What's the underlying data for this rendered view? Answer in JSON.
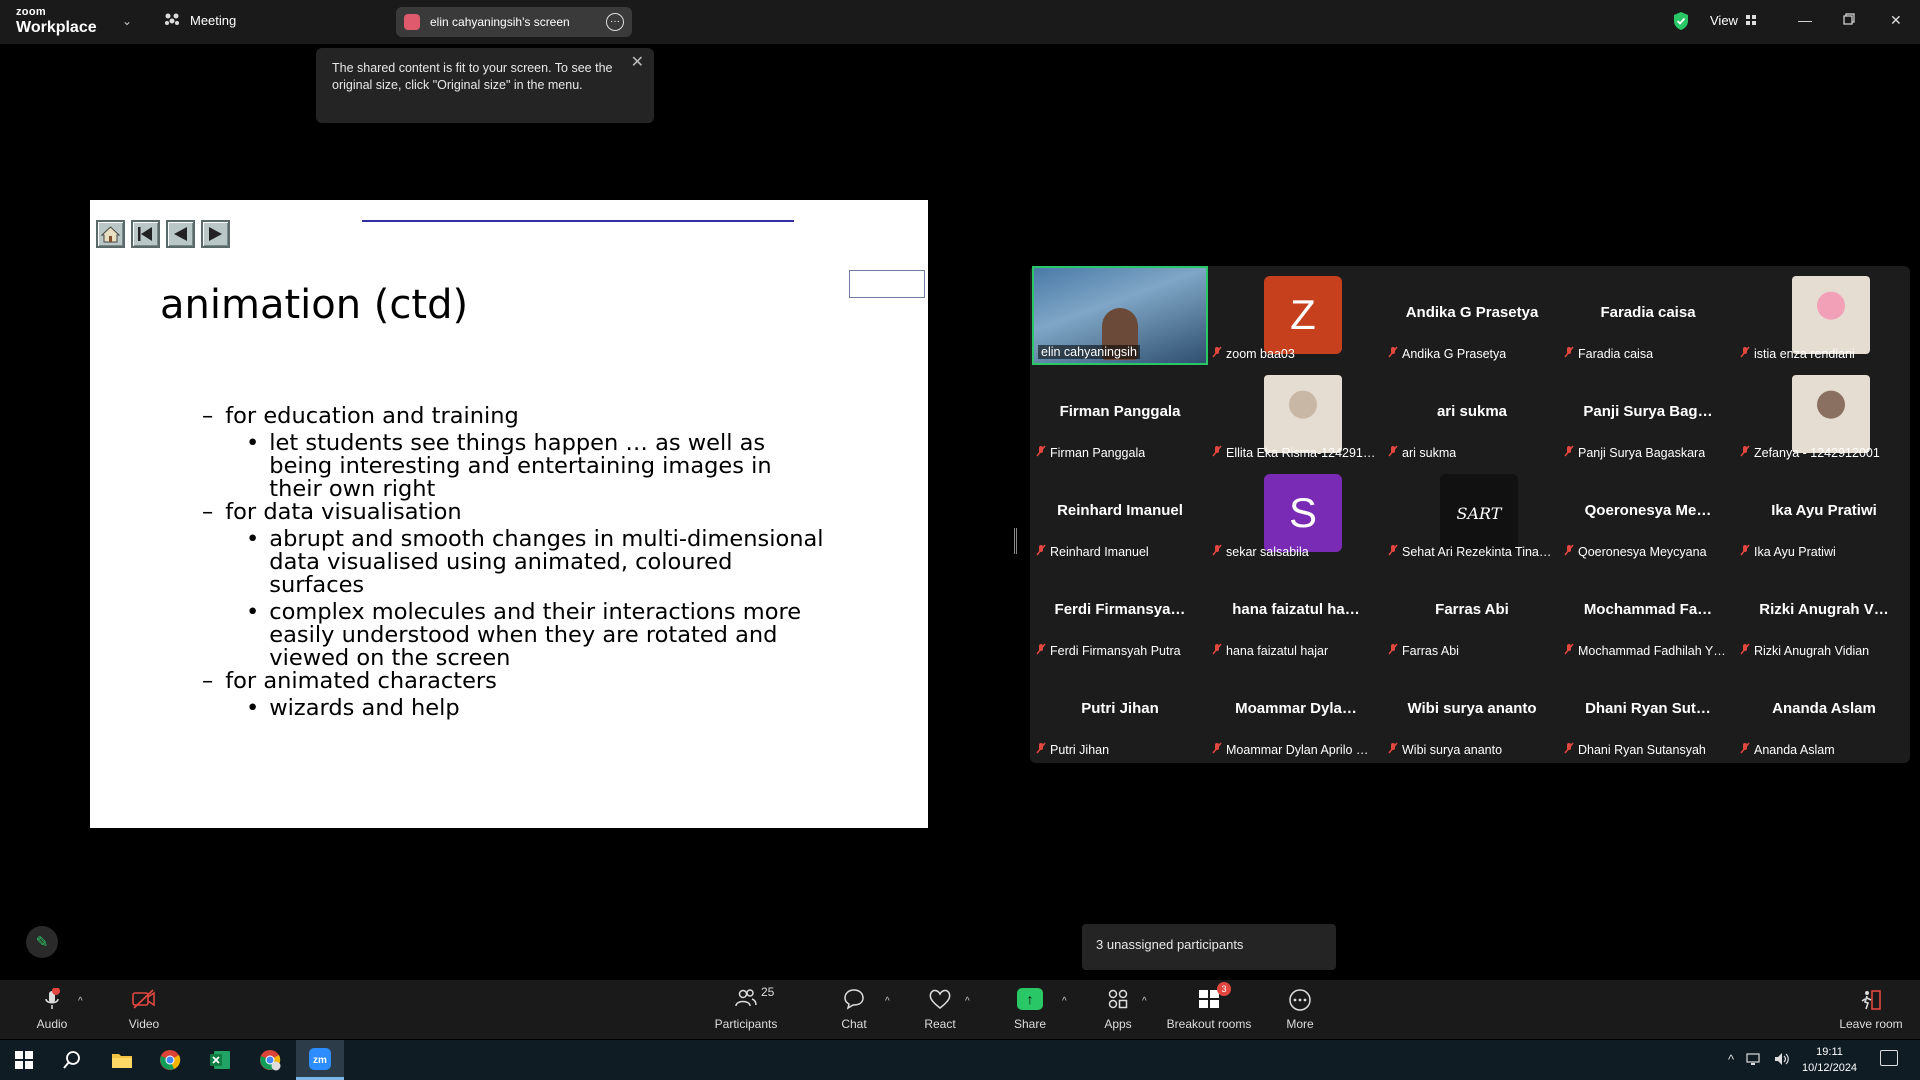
{
  "titlebar": {
    "brand_top": "zoom",
    "brand_bottom": "Workplace",
    "meeting_label": "Meeting",
    "share_label": "elin cahyaningsih's screen",
    "view_label": "View"
  },
  "tooltip": {
    "text": "The shared content is fit to your screen. To see the original size, click \"Original size\" in the menu."
  },
  "slide": {
    "title": "animation (ctd)",
    "sections": [
      {
        "heading": "for education and training",
        "items": [
          "let students see things happen … as well as being interesting and entertaining images in their own right"
        ]
      },
      {
        "heading": "for data visualisation",
        "items": [
          "abrupt and smooth changes in multi-dimensional data visualised using animated, coloured surfaces",
          "complex molecules and their interactions more easily understood when they are rotated and viewed on the screen"
        ]
      },
      {
        "heading": "for animated characters",
        "items": [
          "wizards and help"
        ]
      }
    ]
  },
  "participants": [
    {
      "name": "",
      "label": "elin cahyaningsih",
      "muted": false,
      "type": "video"
    },
    {
      "name": "",
      "label": "zoom baa03",
      "muted": true,
      "type": "avatar",
      "letter": "Z",
      "color": "#c6401d"
    },
    {
      "name": "Andika G Prasetya",
      "label": "Andika G Prasetya",
      "muted": true,
      "type": "name"
    },
    {
      "name": "Faradia caisa",
      "label": "Faradia caisa",
      "muted": true,
      "type": "name"
    },
    {
      "name": "",
      "label": "istia enza rendiani",
      "muted": true,
      "type": "photo",
      "color": "#f2a0b8"
    },
    {
      "name": "Firman Panggala",
      "label": "Firman Panggala",
      "muted": true,
      "type": "name"
    },
    {
      "name": "",
      "label": "Ellita Eka Risma-124291…",
      "muted": true,
      "type": "photo",
      "color": "#c9b7a5"
    },
    {
      "name": "ari sukma",
      "label": "ari sukma",
      "muted": true,
      "type": "name"
    },
    {
      "name": "Panji Surya Bag…",
      "label": "Panji Surya Bagaskara",
      "muted": true,
      "type": "name"
    },
    {
      "name": "",
      "label": "Zefanya - 1242912001",
      "muted": true,
      "type": "photo",
      "color": "#8a7060"
    },
    {
      "name": "Reinhard Imanuel",
      "label": "Reinhard Imanuel",
      "muted": true,
      "type": "name"
    },
    {
      "name": "",
      "label": "sekar salsabila",
      "muted": true,
      "type": "avatar",
      "letter": "S",
      "color": "#7a2bb5"
    },
    {
      "name": "",
      "label": "Sehat Ari Rezekinta Tina…",
      "muted": true,
      "type": "logo",
      "letter": "SART",
      "color": "#111111"
    },
    {
      "name": "Qoeronesya  Me…",
      "label": "Qoeronesya Meycyana",
      "muted": true,
      "type": "name"
    },
    {
      "name": "Ika Ayu Pratiwi",
      "label": "Ika Ayu Pratiwi",
      "muted": true,
      "type": "name"
    },
    {
      "name": "Ferdi  Firmansya…",
      "label": "Ferdi Firmansyah Putra",
      "muted": true,
      "type": "name"
    },
    {
      "name": "hana faizatul ha…",
      "label": "hana faizatul hajar",
      "muted": true,
      "type": "name"
    },
    {
      "name": "Farras Abi",
      "label": "Farras Abi",
      "muted": true,
      "type": "name"
    },
    {
      "name": "Mochammad  Fa…",
      "label": "Mochammad Fadhilah Y…",
      "muted": true,
      "type": "name"
    },
    {
      "name": "Rizki Anugrah  V…",
      "label": "Rizki Anugrah Vidian",
      "muted": true,
      "type": "name"
    },
    {
      "name": "Putri Jihan",
      "label": "Putri Jihan",
      "muted": true,
      "type": "name"
    },
    {
      "name": "Moammar  Dyla…",
      "label": "Moammar Dylan Aprilo …",
      "muted": true,
      "type": "name"
    },
    {
      "name": "Wibi surya ananto",
      "label": "Wibi surya ananto",
      "muted": true,
      "type": "name"
    },
    {
      "name": "Dhani Ryan Sut…",
      "label": "Dhani Ryan Sutansyah",
      "muted": true,
      "type": "name"
    },
    {
      "name": "Ananda Aslam",
      "label": "Ananda Aslam",
      "muted": true,
      "type": "name"
    }
  ],
  "unassigned": "3 unassigned participants",
  "toolbar": {
    "audio": "Audio",
    "video": "Video",
    "participants": "Participants",
    "participants_count": "25",
    "chat": "Chat",
    "react": "React",
    "share": "Share",
    "apps": "Apps",
    "breakout": "Breakout rooms",
    "breakout_badge": "3",
    "more": "More",
    "leave": "Leave room"
  },
  "taskbar": {
    "time": "19:11",
    "date": "10/12/2024"
  }
}
